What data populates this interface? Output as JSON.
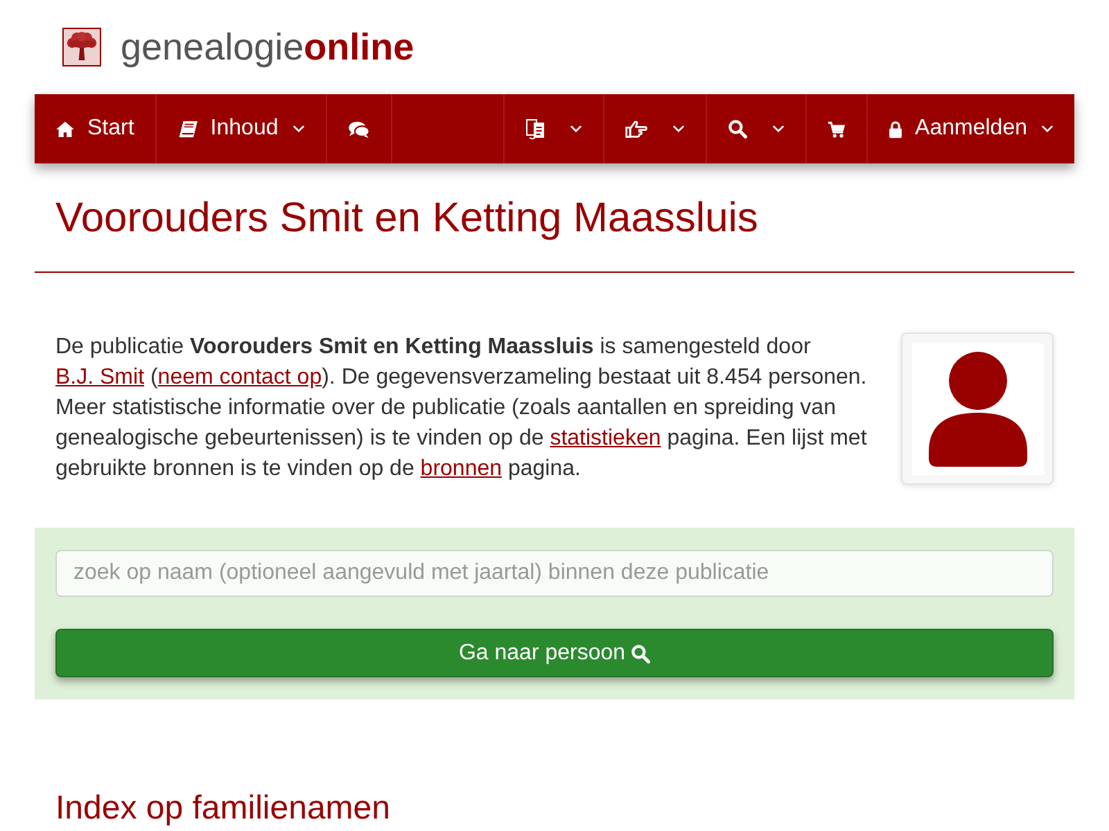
{
  "logo": "genealogie**online**",
  "nav": {
    "left": [
      {
        "kind": "home",
        "label": "Start",
        "dropdown": false
      },
      {
        "kind": "book",
        "label": "Inhoud",
        "dropdown": true
      },
      {
        "kind": "chat",
        "dropdown": false
      }
    ],
    "right": [
      {
        "kind": "translate",
        "dropdown": true
      },
      {
        "kind": "hand",
        "dropdown": true
      },
      {
        "kind": "search",
        "dropdown": true
      },
      {
        "kind": "cart",
        "dropdown": false
      },
      {
        "kind": "lock",
        "label": "Aanmelden",
        "dropdown": true
      }
    ]
  },
  "title": "Voorouders Smit en Ketting Maassluis",
  "intro": [
    {
      "kind": "text",
      "text": "De publicatie **Voorouders Smit en Ketting Maassluis** is samengesteld door "
    },
    {
      "kind": "link",
      "text": "B.J. Smit"
    },
    {
      "kind": "text",
      "text": " ("
    },
    {
      "kind": "link",
      "text": "neem contact op"
    },
    {
      "kind": "text",
      "text": "). De gegevensverzameling bestaat uit 8.454 personen. Meer statistische informatie over de publicatie (zoals aantallen en spreiding van genealogische gebeurtenissen) is te vinden op de "
    },
    {
      "kind": "link",
      "text": "statistieken"
    },
    {
      "kind": "text",
      "text": " pagina. Een lijst met gebruikte bronnen is te vinden op de "
    },
    {
      "kind": "link",
      "text": "bronnen"
    },
    {
      "kind": "text",
      "text": " pagina."
    }
  ],
  "search": {
    "placeholder": "zoek op naam (optioneel aangevuld met jaartal) binnen deze publicatie",
    "button": "Ga naar persoon"
  },
  "section_heading": "Index op familienamen"
}
